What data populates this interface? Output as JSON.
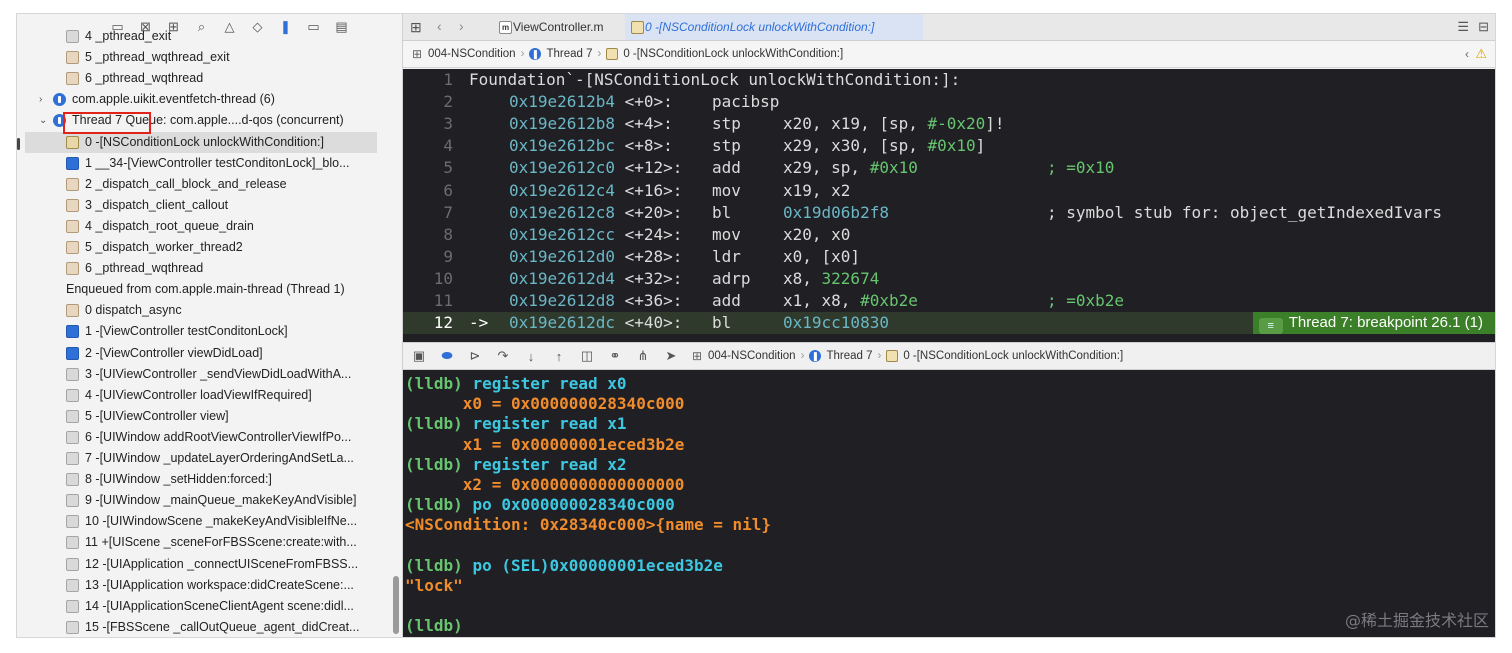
{
  "navigator": {
    "toolbar_icons": [
      "folder-icon",
      "close-square-icon",
      "hierarchy-icon",
      "search-icon",
      "warning-icon",
      "diamond-icon",
      "thread-navigator-icon",
      "breakpoint-icon",
      "report-icon"
    ],
    "rows": [
      {
        "label": "4 _pthread_exit",
        "icon": "sys"
      },
      {
        "label": "5 _pthread_wqthread_exit",
        "icon": "gear"
      },
      {
        "label": "6 _pthread_wqthread",
        "icon": "gear"
      },
      {
        "label": "com.apple.uikit.eventfetch-thread (6)",
        "icon": "thread"
      },
      {
        "label": "Thread 7 Queue: com.apple....d-qos (concurrent)",
        "icon": "thread"
      },
      {
        "label": "0 -[NSConditionLock unlockWithCondition:]",
        "icon": "lock"
      },
      {
        "label": "1 __34-[ViewController testConditonLock]_blo...",
        "icon": "user"
      },
      {
        "label": "2 _dispatch_call_block_and_release",
        "icon": "gear"
      },
      {
        "label": "3 _dispatch_client_callout",
        "icon": "gear"
      },
      {
        "label": "4 _dispatch_root_queue_drain",
        "icon": "gear"
      },
      {
        "label": "5 _dispatch_worker_thread2",
        "icon": "gear"
      },
      {
        "label": "6 _pthread_wqthread",
        "icon": "gear"
      },
      {
        "label": "Enqueued from com.apple.main-thread (Thread 1)",
        "icon": "none"
      },
      {
        "label": "0 dispatch_async",
        "icon": "gear"
      },
      {
        "label": "1 -[ViewController testConditonLock]",
        "icon": "user"
      },
      {
        "label": "2 -[ViewController viewDidLoad]",
        "icon": "user"
      },
      {
        "label": "3 -[UIViewController _sendViewDidLoadWithA...",
        "icon": "sys"
      },
      {
        "label": "4 -[UIViewController loadViewIfRequired]",
        "icon": "sys"
      },
      {
        "label": "5 -[UIViewController view]",
        "icon": "sys"
      },
      {
        "label": "6 -[UIWindow addRootViewControllerViewIfPo...",
        "icon": "sys"
      },
      {
        "label": "7 -[UIWindow _updateLayerOrderingAndSetLa...",
        "icon": "sys"
      },
      {
        "label": "8 -[UIWindow _setHidden:forced:]",
        "icon": "sys"
      },
      {
        "label": "9 -[UIWindow _mainQueue_makeKeyAndVisible]",
        "icon": "sys"
      },
      {
        "label": "10 -[UIWindowScene _makeKeyAndVisibleIfNe...",
        "icon": "sys"
      },
      {
        "label": "11 +[UIScene _sceneForFBSScene:create:with...",
        "icon": "sys"
      },
      {
        "label": "12 -[UIApplication _connectUISceneFromFBSS...",
        "icon": "sys"
      },
      {
        "label": "13 -[UIApplication workspace:didCreateScene:...",
        "icon": "sys"
      },
      {
        "label": "14 -[UIApplicationSceneClientAgent scene:didl...",
        "icon": "sys"
      },
      {
        "label": "15 -[FBSScene _callOutQueue_agent_didCreat...",
        "icon": "sys"
      }
    ]
  },
  "tabs": [
    {
      "label": "ViewController.m",
      "icon": "objc-file-icon"
    },
    {
      "label": "0 -[NSConditionLock unlockWithCondition:]",
      "icon": "stack-frame-icon",
      "active": true
    }
  ],
  "jumpbar": {
    "project": "004-NSCondition",
    "thread": "Thread 7",
    "frame": "0 -[NSConditionLock unlockWithCondition:]"
  },
  "code": {
    "header": "Foundation`-[NSConditionLock unlockWithCondition:]:",
    "lines": [
      {
        "n": "1"
      },
      {
        "n": "2",
        "addr": "0x19e2612b4",
        "off": "<+0>:",
        "mn": "pacibsp",
        "ops": "",
        "cmt": ""
      },
      {
        "n": "3",
        "addr": "0x19e2612b8",
        "off": "<+4>:",
        "mn": "stp",
        "ops": "x20, x19, [sp, ",
        "num": "#-0x20",
        "tail": "]!",
        "cmt": ""
      },
      {
        "n": "4",
        "addr": "0x19e2612bc",
        "off": "<+8>:",
        "mn": "stp",
        "ops": "x29, x30, [sp, ",
        "num": "#0x10",
        "tail": "]",
        "cmt": ""
      },
      {
        "n": "5",
        "addr": "0x19e2612c0",
        "off": "<+12>:",
        "mn": "add",
        "ops": "x29, sp, ",
        "num": "#0x10",
        "tail": "",
        "cmt": "; =0x10"
      },
      {
        "n": "6",
        "addr": "0x19e2612c4",
        "off": "<+16>:",
        "mn": "mov",
        "ops": "x19, x2",
        "cmt": ""
      },
      {
        "n": "7",
        "addr": "0x19e2612c8",
        "off": "<+20>:",
        "mn": "bl",
        "ops": "",
        "num": "0x19d06b2f8",
        "tail": "",
        "cmt": "; symbol stub for: object_getIndexedIvars"
      },
      {
        "n": "8",
        "addr": "0x19e2612cc",
        "off": "<+24>:",
        "mn": "mov",
        "ops": "x20, x0",
        "cmt": ""
      },
      {
        "n": "9",
        "addr": "0x19e2612d0",
        "off": "<+28>:",
        "mn": "ldr",
        "ops": "x0, [x0]",
        "cmt": ""
      },
      {
        "n": "10",
        "addr": "0x19e2612d4",
        "off": "<+32>:",
        "mn": "adrp",
        "ops": "x8, ",
        "num": "322674",
        "tail": "",
        "cmt": ""
      },
      {
        "n": "11",
        "addr": "0x19e2612d8",
        "off": "<+36>:",
        "mn": "add",
        "ops": "x1, x8, ",
        "num": "#0xb2e",
        "tail": "",
        "cmt": "; =0xb2e"
      },
      {
        "n": "12",
        "arrow": "->",
        "addr": "0x19e2612dc",
        "off": "<+40>:",
        "mn": "bl",
        "ops": "",
        "num": "0x19cc10830",
        "tail": "",
        "cmt": ""
      }
    ],
    "breakpoint_badge": "Thread 7: breakpoint 26.1 (1)"
  },
  "console": {
    "lines": [
      {
        "t": "prompt",
        "p": "(lldb) ",
        "c": "register read x0"
      },
      {
        "t": "out",
        "c": "      x0 = 0x000000028340c000"
      },
      {
        "t": "prompt",
        "p": "(lldb) ",
        "c": "register read x1"
      },
      {
        "t": "out",
        "c": "      x1 = 0x00000001eced3b2e"
      },
      {
        "t": "prompt",
        "p": "(lldb) ",
        "c": "register read x2"
      },
      {
        "t": "out",
        "c": "      x2 = 0x0000000000000000"
      },
      {
        "t": "prompt",
        "p": "(lldb) ",
        "c": "po 0x000000028340c000"
      },
      {
        "t": "out",
        "c": "<NSCondition: 0x28340c000>{name = nil}"
      },
      {
        "t": "blank",
        "c": ""
      },
      {
        "t": "prompt",
        "p": "(lldb) ",
        "c": "po (SEL)0x00000001eced3b2e"
      },
      {
        "t": "out",
        "c": "\"lock\""
      },
      {
        "t": "blank",
        "c": ""
      },
      {
        "t": "prompt",
        "p": "(lldb)",
        "c": ""
      }
    ],
    "watermark": "@稀土掘金技术社区"
  },
  "colors": {
    "accent": "#2f6fd8",
    "highlight_box": "#e2231a",
    "breakpoint": "#3b7f28"
  }
}
